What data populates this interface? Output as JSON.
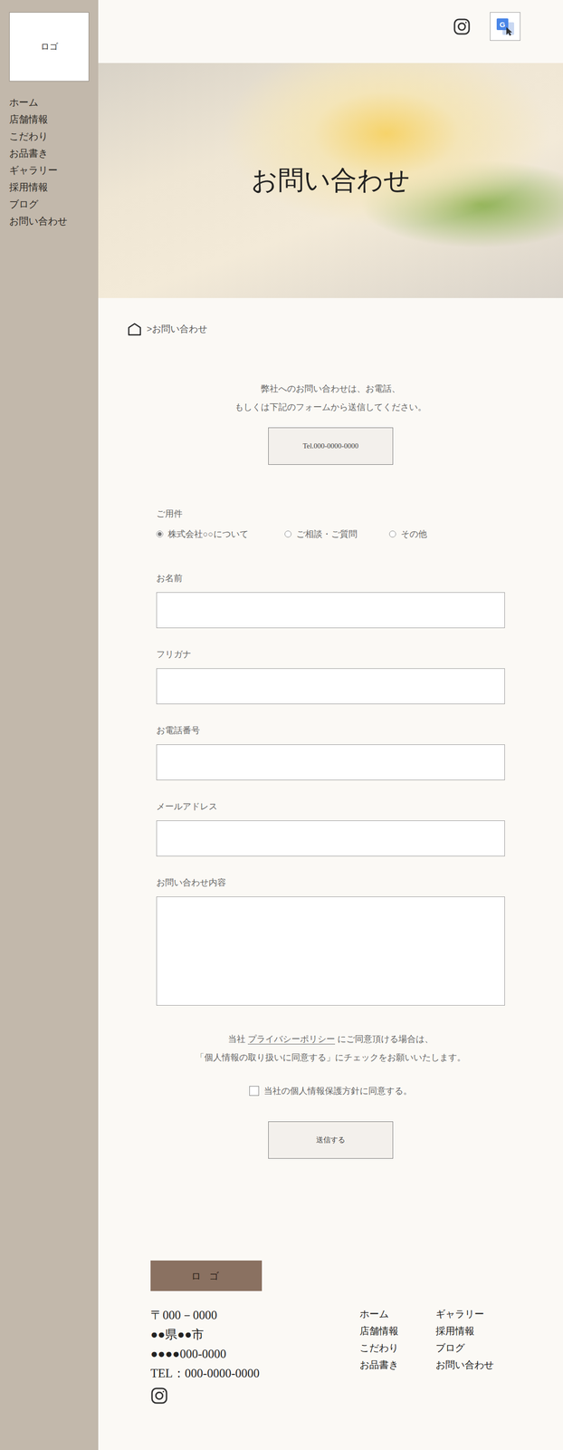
{
  "sidebar": {
    "logo": "ロゴ",
    "items": [
      "ホーム",
      "店舗情報",
      "こだわり",
      "お品書き",
      "ギャラリー",
      "採用情報",
      "ブログ",
      "お問い合わせ"
    ]
  },
  "hero": {
    "title": "お問い合わせ"
  },
  "breadcrumb": {
    "current": ">お問い合わせ"
  },
  "intro": {
    "lines": [
      "弊社へのお問い合わせは、お電話、",
      "もしくは下記のフォームから送信してください。"
    ],
    "tel_button": "Tel.000-0000-0000"
  },
  "form": {
    "purpose": {
      "label": "ご用件",
      "options": [
        {
          "label": "株式会社○○について",
          "selected": true
        },
        {
          "label": "ご相談・ご質問",
          "selected": false
        },
        {
          "label": "その他",
          "selected": false
        }
      ]
    },
    "fields": [
      {
        "label": "お名前",
        "kind": "input"
      },
      {
        "label": "フリガナ",
        "kind": "input"
      },
      {
        "label": "お電話番号",
        "kind": "input"
      },
      {
        "label": "メールアドレス",
        "kind": "input"
      },
      {
        "label": "お問い合わせ内容",
        "kind": "textarea"
      }
    ],
    "privacy": {
      "before": "当社 ",
      "link": "プライバシーポリシー",
      "after": " にご同意頂ける場合は、",
      "line2": "「個人情報の取り扱いに同意する」にチェックをお願いいたします。"
    },
    "consent": {
      "label": "当社の個人情報保護方針に同意する。",
      "checked": false
    },
    "submit": "送信する"
  },
  "footer": {
    "logo": "ロ ゴ",
    "address": [
      "〒000－0000",
      "●●県●●市",
      "●●●●000-0000",
      "TEL：000-0000-0000"
    ],
    "nav": [
      "ホーム",
      "店舗情報",
      "こだわり",
      "お品書き",
      "ギャラリー",
      "採用情報",
      "ブログ",
      "お問い合わせ"
    ]
  }
}
